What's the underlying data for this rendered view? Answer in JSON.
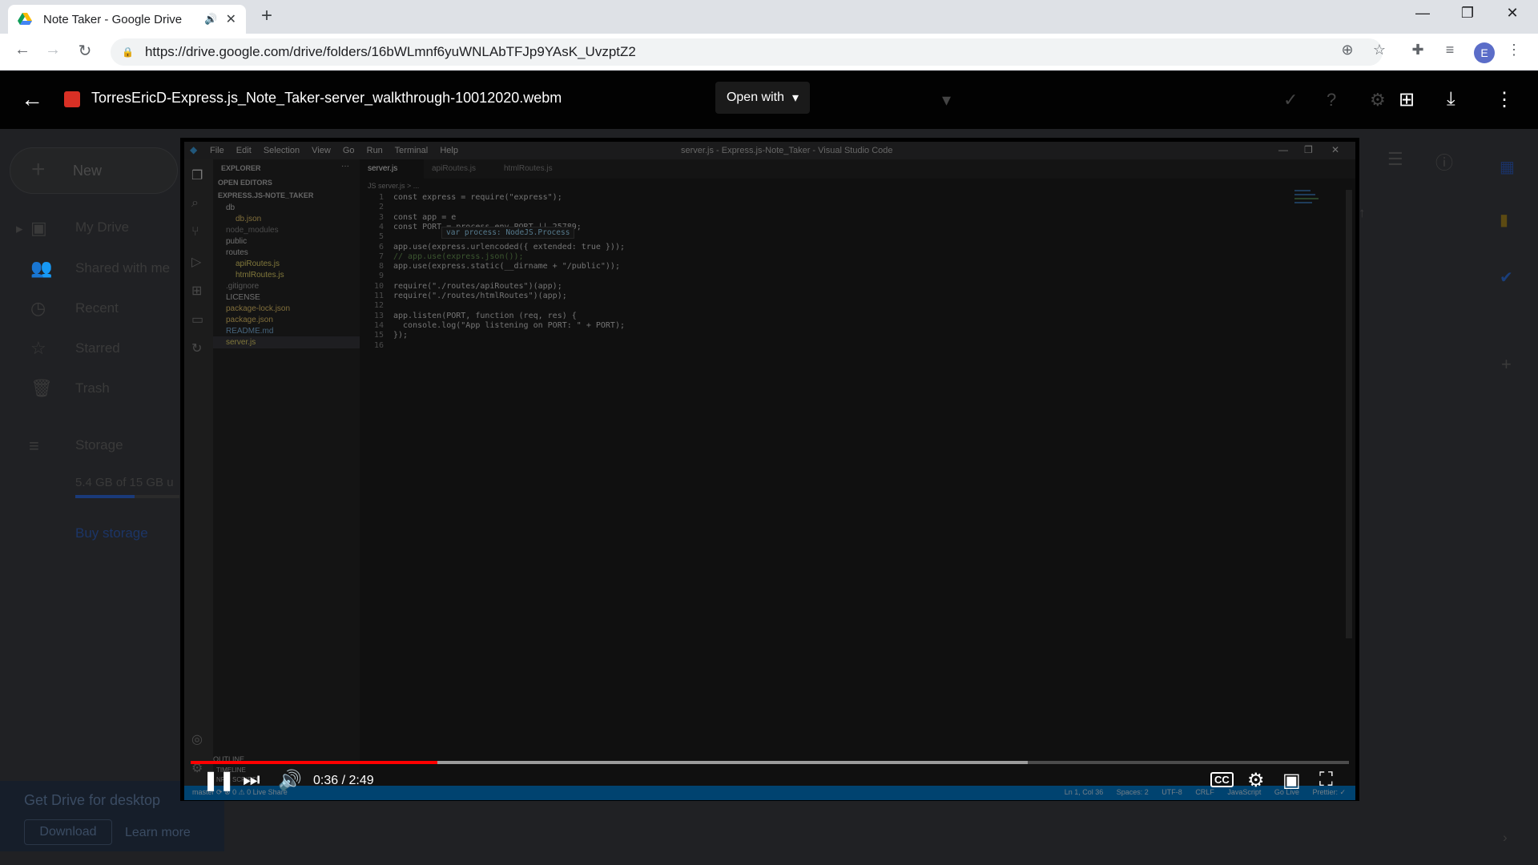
{
  "browser": {
    "tab_title": "Note Taker - Google Drive",
    "new_tab": "+",
    "url": "https://drive.google.com/drive/folders/16bWLmnf6yuWNLAbTFJp9YAsK_UvzptZ2",
    "profile_initial": "E"
  },
  "viewer": {
    "file_name": "TorresEricD-Express.js_Note_Taker-server_walkthrough-10012020.webm",
    "open_with": "Open with"
  },
  "drive": {
    "new_label": "New",
    "nav": [
      "My Drive",
      "Shared with me",
      "Recent",
      "Starred",
      "Trash"
    ],
    "storage_label": "Storage",
    "storage_used": "5.4 GB of 15 GB u",
    "storage_fraction": 0.36,
    "buy_storage": "Buy storage",
    "promo_title": "Get Drive for desktop",
    "promo_download": "Download",
    "promo_learn": "Learn more"
  },
  "vscode": {
    "menu": [
      "File",
      "Edit",
      "Selection",
      "View",
      "Go",
      "Run",
      "Terminal",
      "Help"
    ],
    "window_title": "server.js - Express.js-Note_Taker - Visual Studio Code",
    "explorer_title": "EXPLORER",
    "open_editors": "OPEN EDITORS",
    "project": "EXPRESS.JS-NOTE_TAKER",
    "tree": [
      "db",
      "db.json",
      "node_modules",
      "public",
      "routes",
      "apiRoutes.js",
      "htmlRoutes.js",
      ".gitignore",
      "LICENSE",
      "package-lock.json",
      "package.json",
      "README.md",
      "server.js"
    ],
    "tabs": [
      "server.js",
      "apiRoutes.js",
      "htmlRoutes.js"
    ],
    "breadcrumb": "JS server.js > ...",
    "hover_text": "var process: NodeJS.Process",
    "lines": [
      "const express = require(\"express\");",
      "",
      "const app = e",
      "const PORT = process.env.PORT || 25789;",
      "",
      "app.use(express.urlencoded({ extended: true }));",
      "// app.use(express.json());",
      "app.use(express.static(__dirname + \"/public\"));",
      "",
      "require(\"./routes/apiRoutes\")(app);",
      "require(\"./routes/htmlRoutes\")(app);",
      "",
      "app.listen(PORT, function (req, res) {",
      "  console.log(\"App listening on PORT: \" + PORT);",
      "});",
      ""
    ],
    "outline": "OUTLINE",
    "timeline": "TIMELINE",
    "npm_scripts": "NPM SCRIPTS",
    "status_left": "master  ⟳  ⊗ 0 ⚠ 0  Live Share",
    "status_right": [
      "Ln 1, Col 36",
      "Spaces: 2",
      "UTF-8",
      "CRLF",
      "JavaScript",
      "Go Live",
      "Prettier: ✓"
    ]
  },
  "player": {
    "time": "0:36 / 2:49",
    "played_fraction": 0.213,
    "buffered_fraction": 0.723,
    "cc_label": "CC"
  }
}
